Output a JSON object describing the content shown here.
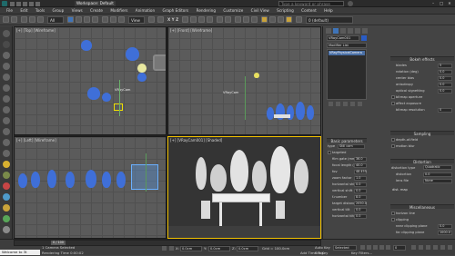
{
  "titlebar": {
    "workspace": "Workspace: Default",
    "title": "",
    "search_placeholder": "Type a keyword or phrase",
    "minimize": "–",
    "maximize": "□",
    "close": "✕"
  },
  "menubar": [
    "File",
    "Edit",
    "Tools",
    "Group",
    "Views",
    "Create",
    "Modifiers",
    "Animation",
    "Graph Editors",
    "Rendering",
    "Customize",
    "Civil View",
    "Scripting",
    "Content",
    "Help"
  ],
  "toolbar": {
    "filter_value": "All",
    "view_value": "View",
    "layer_value": "0 (default)"
  },
  "viewports": {
    "top": "[+] [Top] [Wireframe]",
    "front": "[+] [Front] [Wireframe]",
    "left": "[+] [Left] [Wireframe]",
    "camera": "[+] [VRayCam001] [Shaded]",
    "cam_label": "VRayCam",
    "cam_label_front": "VRayCam"
  },
  "panel": {
    "object_name": "VRayCam001",
    "modifier_list": "Modifier List",
    "stack_item": "VRayPhysicalCamera",
    "basic_params": "Basic parameters",
    "type_label": "type",
    "type_value": "Still cam",
    "params": [
      {
        "label": "targeted",
        "value": ""
      },
      {
        "label": "film gate (mm)",
        "value": "36.0"
      },
      {
        "label": "focal length (mm)",
        "value": "40.0"
      },
      {
        "label": "fov",
        "value": "48.455"
      },
      {
        "label": "zoom factor",
        "value": "1.0"
      },
      {
        "label": "horizontal shift",
        "value": "0.0"
      },
      {
        "label": "vertical shift",
        "value": "0.0"
      },
      {
        "label": "f-number",
        "value": "8.0"
      },
      {
        "label": "target distance",
        "value": "2050.0"
      },
      {
        "label": "vertical tilt",
        "value": "0.0"
      },
      {
        "label": "horizontal tilt",
        "value": "0.0"
      }
    ],
    "bokeh_title": "Bokeh effects",
    "bokeh": [
      {
        "label": "blades",
        "value": "5"
      },
      {
        "label": "rotation (deg)",
        "value": "0.0"
      },
      {
        "label": "center bias",
        "value": "0.0"
      },
      {
        "label": "anisotropy",
        "value": "0.0"
      },
      {
        "label": "optical vignetting",
        "value": "0.0"
      },
      {
        "label": "bitmap aperture",
        "value": ""
      },
      {
        "label": "affect exposure",
        "value": ""
      },
      {
        "label": "bitmap resolution",
        "value": "0"
      }
    ],
    "sampling_title": "Sampling",
    "sampling": [
      {
        "label": "depth-of-field",
        "value": ""
      },
      {
        "label": "motion blur",
        "value": ""
      }
    ],
    "distortion_title": "Distortion",
    "distortion_type_label": "distortion type",
    "distortion_type_value": "Quadratic",
    "distortion": [
      {
        "label": "distortion",
        "value": "0.0"
      },
      {
        "label": "lens file",
        "value": "None"
      }
    ],
    "dist_map": "dist. map",
    "misc_title": "Miscellaneous",
    "misc": [
      {
        "label": "horizon line",
        "value": ""
      },
      {
        "label": "clipping",
        "value": ""
      },
      {
        "label": "near clipping plane",
        "value": "0.0"
      },
      {
        "label": "far clipping plane",
        "value": "1000.0"
      }
    ]
  },
  "statusbar": {
    "frame_counter": "0 / 100",
    "welcome": "Welcome to 3t",
    "selected": "1 Camera Selected",
    "render_time": "Rendering Time 0:00:02",
    "x_label": "X:",
    "x_value": "0.0cm",
    "y_label": "Y:",
    "y_value": "0.0cm",
    "z_label": "Z:",
    "z_value": "0.0cm",
    "grid": "Grid = 100.0cm",
    "add_time_tag": "Add Time Tag",
    "auto_key": "Auto Key",
    "selected_dd": "Selected",
    "set_key": "Set Key",
    "key_filters": "Key Filters...",
    "frame_value": "0"
  },
  "colors": {
    "accent_yellow": "#f0c000",
    "tree_blue": "#3f6fd8",
    "viewport_bg": "#5b5b5b"
  }
}
